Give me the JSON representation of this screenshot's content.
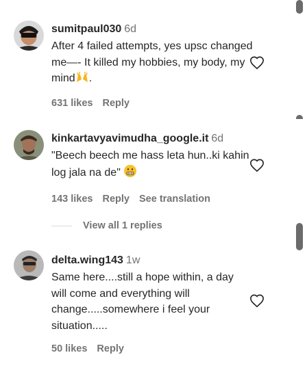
{
  "comments": [
    {
      "username": "sumitpaul030",
      "time": "6d",
      "text": "After 4 failed attempts, yes upsc changed me—- It killed my hobbies, my body, my mind",
      "text_end": ".",
      "emoji": "raised-hands",
      "likes": "631 likes",
      "reply": "Reply"
    },
    {
      "username": "kinkartavyavimudha_google.it",
      "time": "6d",
      "text": "\"Beech beech me hass leta hun..ki kahin log jala na de\"",
      "emoji": "grimacing-face",
      "likes": "143 likes",
      "reply": "Reply",
      "translate": "See translation"
    },
    {
      "username": "delta.wing143",
      "time": "1w",
      "text": "Same here....still a hope within, a day will come and everything will change.....somewhere i feel your situation.....",
      "likes": "50 likes",
      "reply": "Reply"
    }
  ],
  "view_replies": "View all 1 replies",
  "colors": {
    "text": "#262626",
    "secondary": "#737373",
    "scrollbar": "#6b6b6b"
  },
  "icons": [
    "heart-outline-icon",
    "raised-hands-emoji",
    "grimacing-emoji"
  ]
}
